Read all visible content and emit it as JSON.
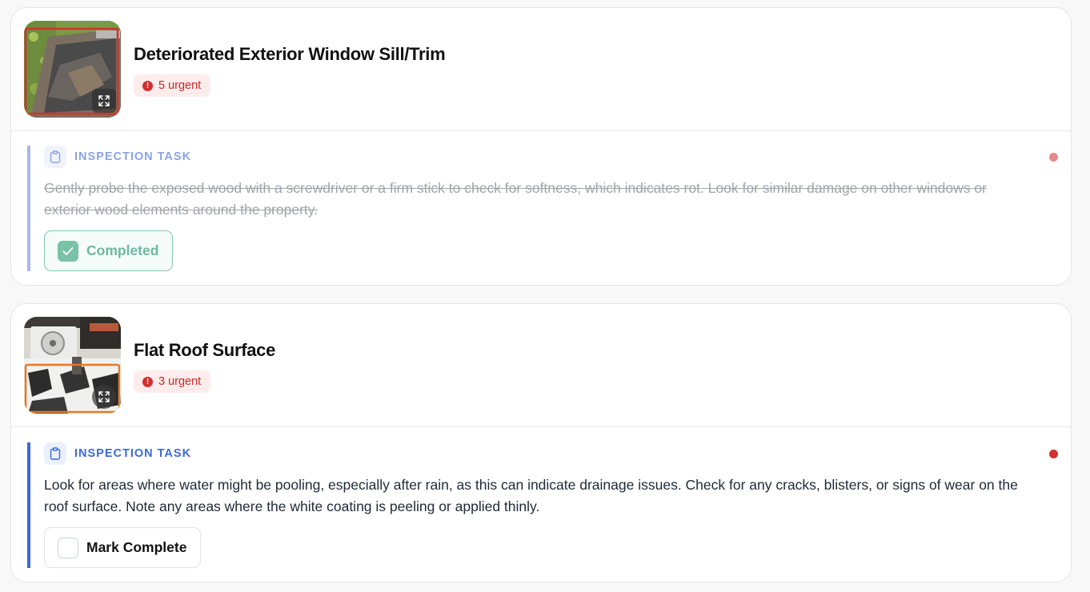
{
  "items": [
    {
      "title": "Deteriorated Exterior Window Sill/Trim",
      "badge": "5 urgent",
      "task_label": "INSPECTION TASK",
      "task_text": "Gently probe the exposed wood with a screwdriver or a firm stick to check for softness, which indicates rot. Look for similar damage on other windows or exterior wood elements around the property.",
      "button_label": "Completed",
      "completed": true
    },
    {
      "title": "Flat Roof Surface",
      "badge": "3 urgent",
      "task_label": "INSPECTION TASK",
      "task_text": "Look for areas where water might be pooling, especially after rain, as this can indicate drainage issues. Check for any cracks, blisters, or signs of wear on the roof surface. Note any areas where the white coating is peeling or applied thinly.",
      "button_label": "Mark Complete",
      "completed": false
    }
  ],
  "icons": {
    "urgent": "alert-circle-icon",
    "expand": "expand-icon",
    "task": "clipboard-icon",
    "check": "check-icon"
  },
  "colors": {
    "accent": "#3b6ad8",
    "urgent": "#d32f2f",
    "completed": "#79c2a8"
  }
}
